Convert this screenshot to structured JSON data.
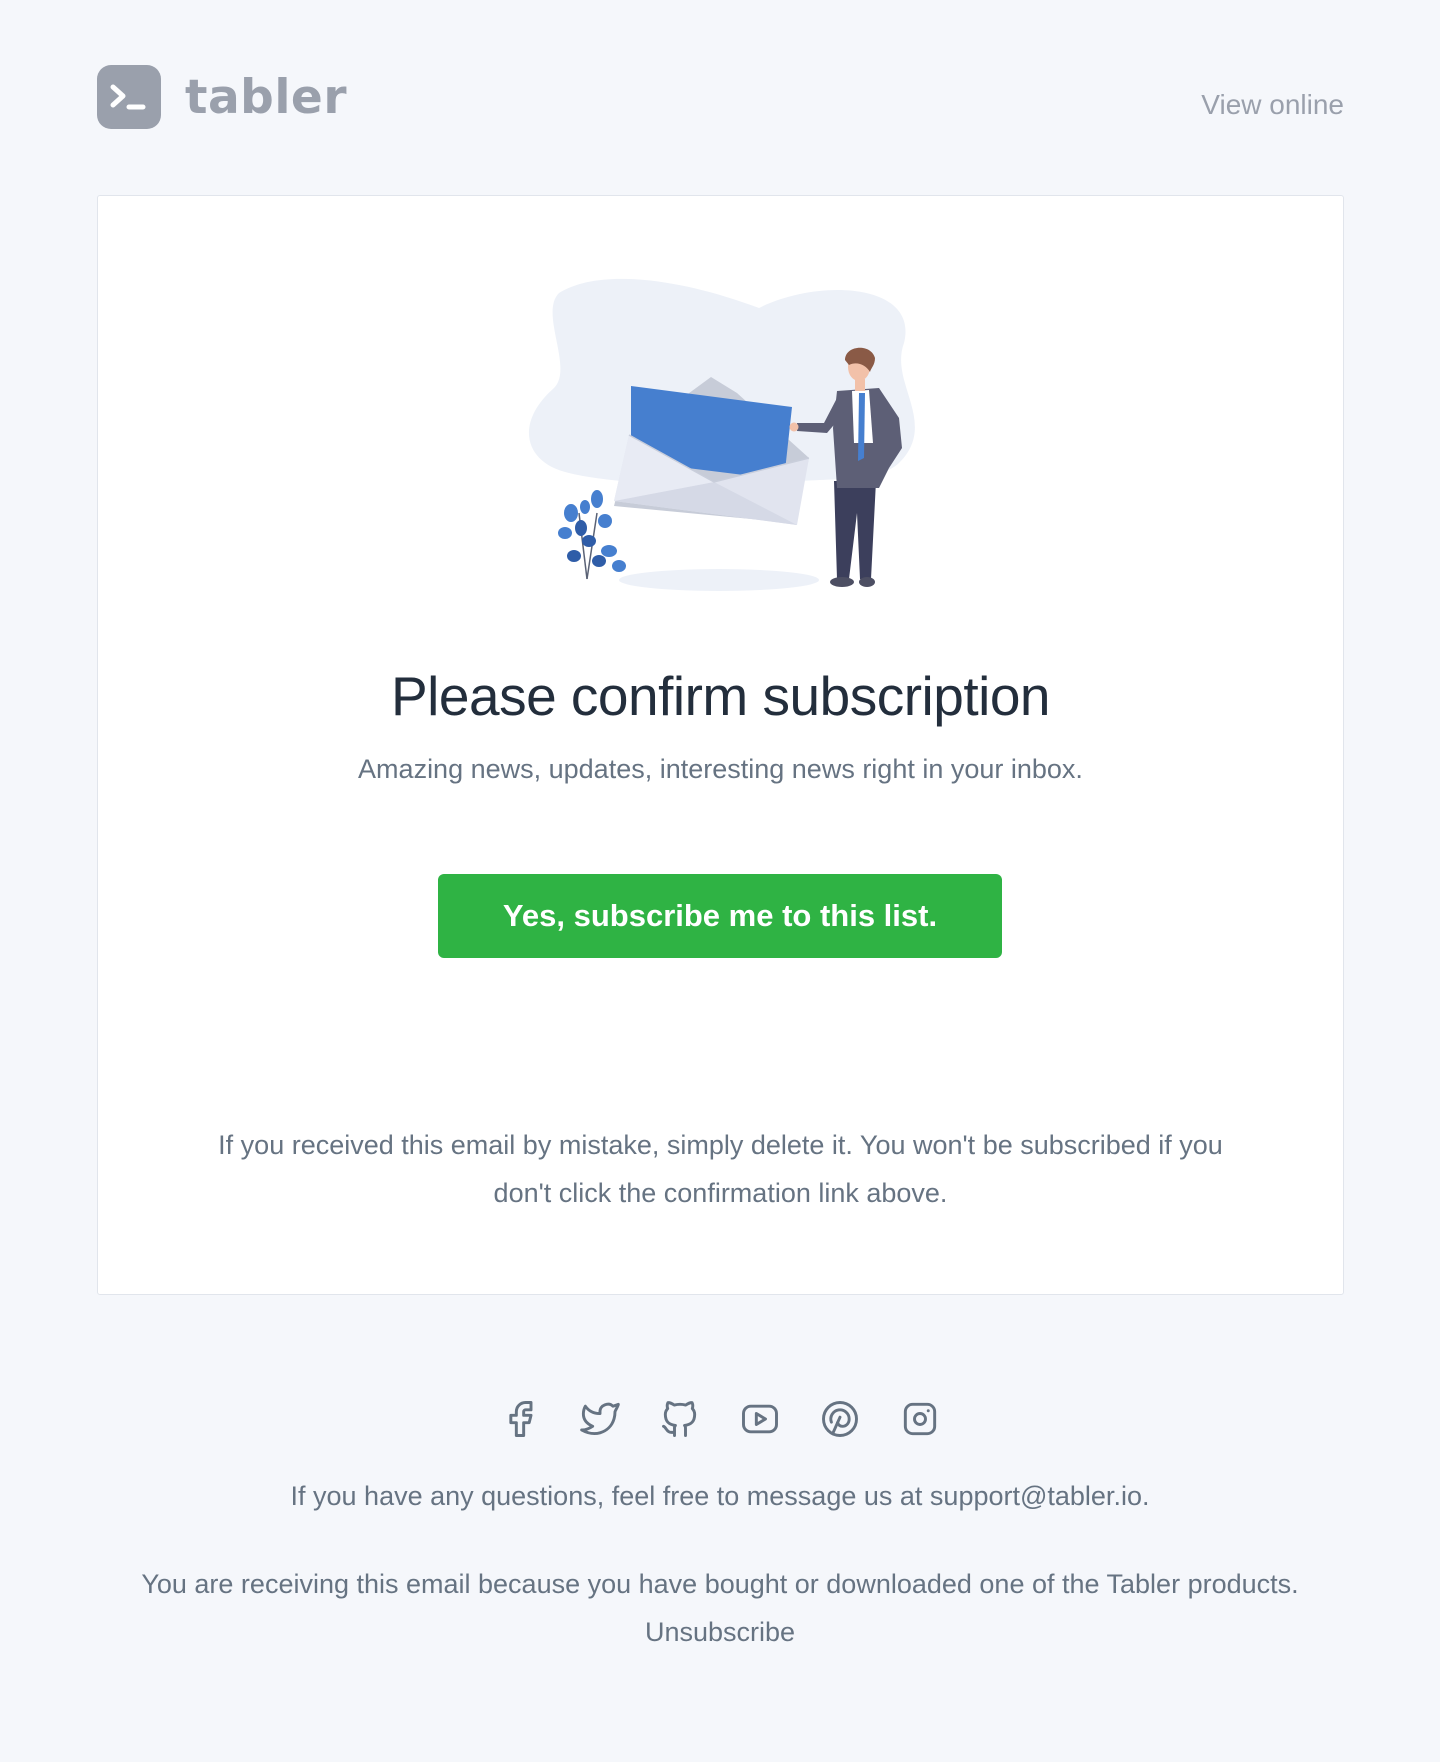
{
  "header": {
    "brand_name": "tabler",
    "view_online_label": "View online"
  },
  "card": {
    "title": "Please confirm subscription",
    "subtitle": "Amazing news, updates, interesting news right in your inbox.",
    "subscribe_button_label": "Yes, subscribe me to this list.",
    "mistake_note": "If you received this email by mistake, simply delete it. You won't be subscribed if you don't click the confirmation link above."
  },
  "footer": {
    "social_icons": [
      "facebook-icon",
      "twitter-icon",
      "github-icon",
      "youtube-icon",
      "pinterest-icon",
      "instagram-icon"
    ],
    "questions_text": "If you have any questions, feel free to message us at",
    "support_email": "support@tabler.io",
    "questions_suffix": ".",
    "receiving_text": "You are receiving this email because you have bought or downloaded one of the Tabler products.",
    "unsubscribe_label": "Unsubscribe"
  },
  "colors": {
    "background": "#f5f7fb",
    "brand_gray": "#9aa0ac",
    "button_green": "#2fb344",
    "title_text": "#232e3c",
    "body_text": "#667382",
    "illustration_blue": "#467fcf"
  }
}
